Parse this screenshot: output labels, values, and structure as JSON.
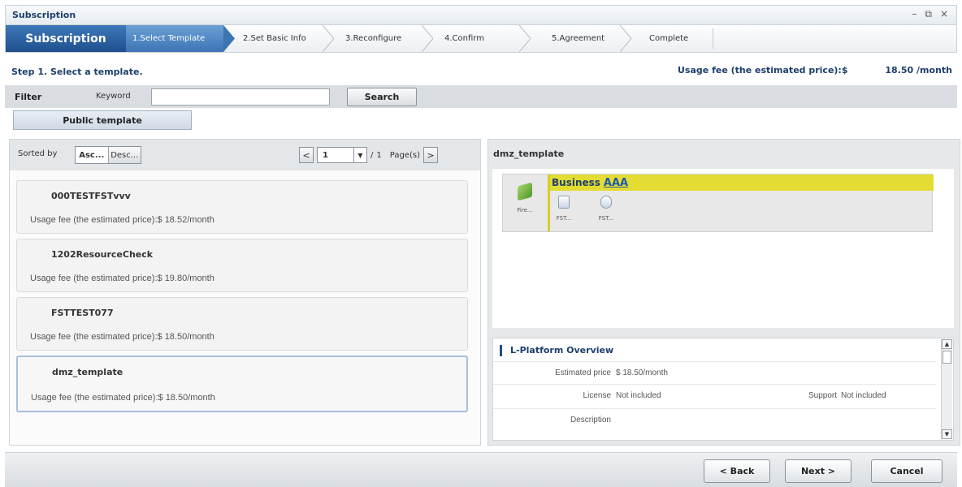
{
  "window": {
    "title": "Subscription",
    "controls": [
      "–",
      "⧉",
      "×"
    ]
  },
  "wizard": {
    "title": "Subscription",
    "steps": [
      "1.Select Template",
      "2.Set Basic Info",
      "3.Reconfigure",
      "4.Confirm",
      "5.Agreement",
      "Complete"
    ],
    "active_index": 0
  },
  "step_header": {
    "title": "Step 1. Select a template.",
    "fee_label": "Usage fee (the estimated price):$",
    "fee_value": "18.50 /month"
  },
  "filter": {
    "label": "Filter",
    "keyword_label": "Keyword",
    "keyword_value": "",
    "search_label": "Search"
  },
  "tab": {
    "label": "Public template"
  },
  "sort": {
    "label": "Sorted by",
    "asc": "Asc...",
    "desc": "Desc..."
  },
  "pager": {
    "prev": "<",
    "current": "1",
    "separator": "/",
    "total": "1",
    "suffix": "Page(s)",
    "next": ">"
  },
  "templates": [
    {
      "name": "000TESTFSTvvv",
      "fee": "Usage fee (the estimated price):$ 18.52/month"
    },
    {
      "name": "1202ResourceCheck",
      "fee": "Usage fee (the estimated price):$ 19.80/month"
    },
    {
      "name": "FSTTEST077",
      "fee": "Usage fee (the estimated price):$ 18.50/month"
    },
    {
      "name": "dmz_template",
      "fee": "Usage fee (the estimated price):$ 18.50/month",
      "selected": true
    }
  ],
  "detail": {
    "title": "dmz_template",
    "diagram": {
      "firewall_label": "Fire...",
      "segment_name": "Business",
      "segment_link": "AAA",
      "servers": [
        "FST...",
        "FST..."
      ]
    },
    "overview": {
      "heading": "L-Platform Overview",
      "estimated_price_label": "Estimated price",
      "estimated_price_value": "$ 18.50/month",
      "license_label": "License",
      "license_value": "Not included",
      "support_label": "Support",
      "support_value": "Not included",
      "description_label": "Description",
      "description_value": ""
    }
  },
  "buttons": {
    "back": "< Back",
    "next": "Next >",
    "cancel": "Cancel"
  },
  "colors": {
    "wizard_title_bg": "#1d4f8c",
    "active_step_bg": "#3c74b4",
    "segment_yellow": "#e3dc33"
  }
}
